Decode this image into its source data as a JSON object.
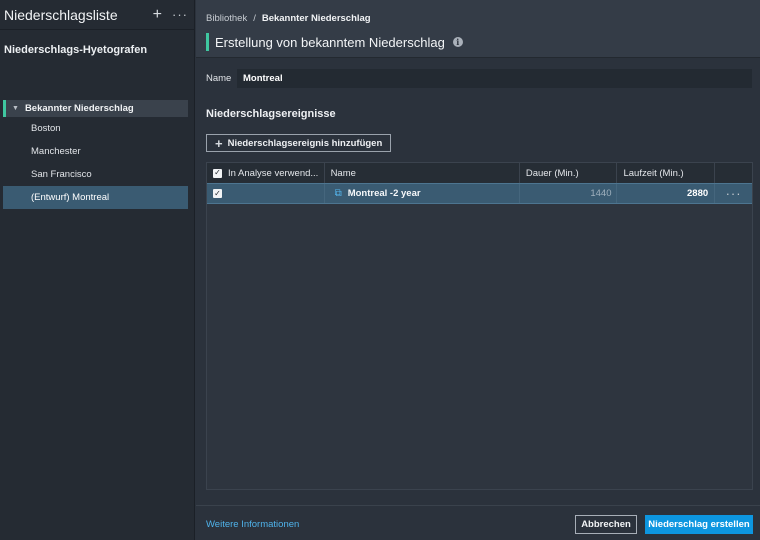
{
  "sidebar": {
    "title": "Niederschlagsliste",
    "add_icon": "plus-icon",
    "more_icon": "more-horizontal-icon",
    "section_title": "Niederschlags-Hyetografen",
    "group": {
      "label": "Bekannter Niederschlag",
      "items": [
        {
          "label": "Boston"
        },
        {
          "label": "Manchester"
        },
        {
          "label": "San Francisco"
        },
        {
          "label": "(Entwurf) Montreal"
        }
      ]
    }
  },
  "header": {
    "breadcrumb_root": "Bibliothek",
    "breadcrumb_sep": "/",
    "breadcrumb_current": "Bekannter Niederschlag",
    "title": "Erstellung von bekanntem Niederschlag",
    "info_glyph": "i"
  },
  "form": {
    "name_label": "Name",
    "name_value": "Montreal",
    "events_heading": "Niederschlagsereignisse",
    "add_event_label": "Niederschlagsereignis hinzufügen"
  },
  "table": {
    "headers": [
      "In Analyse verwend...",
      "Name",
      "Dauer (Min.)",
      "Laufzeit (Min.)"
    ],
    "rows": [
      {
        "checked": true,
        "name": "Montreal -2 year",
        "duration": "1440",
        "runtime": "2880"
      }
    ]
  },
  "footer": {
    "more_info": "Weitere Informationen",
    "cancel_label": "Abbrechen",
    "create_label": "Niederschlag erstellen"
  },
  "colors": {
    "accent": "#3fc7a0",
    "primary_button": "#0d96e0",
    "selection": "#3a5b72",
    "link": "#4fb2ea"
  }
}
